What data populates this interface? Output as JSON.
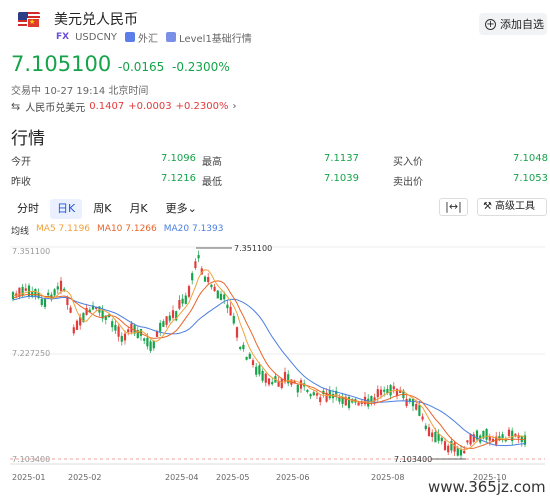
{
  "header": {
    "title": "美元兑人民币",
    "fx_tag": "FX",
    "symbol": "USDCNY",
    "category": "外汇",
    "level": "Level1基础行情",
    "add_button": "添加自选",
    "icons": {
      "flag": "us-cn-flag-icon",
      "add": "plus-circle-icon"
    }
  },
  "quote": {
    "price": "7.105100",
    "change": "-0.0165",
    "change_pct": "-0.2300%",
    "status": "交易中 10-27 19:14 北京时间",
    "reverse_pair_label": "人民币兑美元",
    "reverse_price": "0.1407",
    "reverse_change": "+0.0003",
    "reverse_pct": "+0.2300%"
  },
  "section_title": "行情",
  "stats": {
    "open_label": "今开",
    "open": "7.1096",
    "high_label": "最高",
    "high": "7.1137",
    "bid_label": "买入价",
    "bid": "7.1048",
    "prev_label": "昨收",
    "prev": "7.1216",
    "low_label": "最低",
    "low": "7.1039",
    "ask_label": "卖出价",
    "ask": "7.1053"
  },
  "tabs": [
    "分时",
    "日K",
    "周K",
    "月K",
    "更多"
  ],
  "active_tab": 1,
  "toolbar": {
    "fit_icon": "fit-width-icon",
    "tools_label": "高级工具",
    "tools_icon": "tools-icon"
  },
  "ma": {
    "label": "均线",
    "ma5": "MA5 7.1196",
    "ma10": "MA10 7.1266",
    "ma20": "MA20 7.1393"
  },
  "colors": {
    "up": "#e23b3b",
    "down": "#16a34a",
    "ma5": "#f0a13b",
    "ma10": "#e8652a",
    "ma20": "#4a7fe0"
  },
  "chart_data": {
    "type": "candlestick",
    "y_ticks": [
      "7.351100",
      "7.227250",
      "7.103400"
    ],
    "x_ticks": [
      "2025-01",
      "2025-02",
      "2025-04",
      "2025-05",
      "2025-06",
      "2025-08",
      "2025-10"
    ],
    "max_label": "7.351100",
    "min_label": "7.103400",
    "ylim": [
      7.1034,
      7.3511
    ]
  },
  "watermark": "www.365jz.com"
}
